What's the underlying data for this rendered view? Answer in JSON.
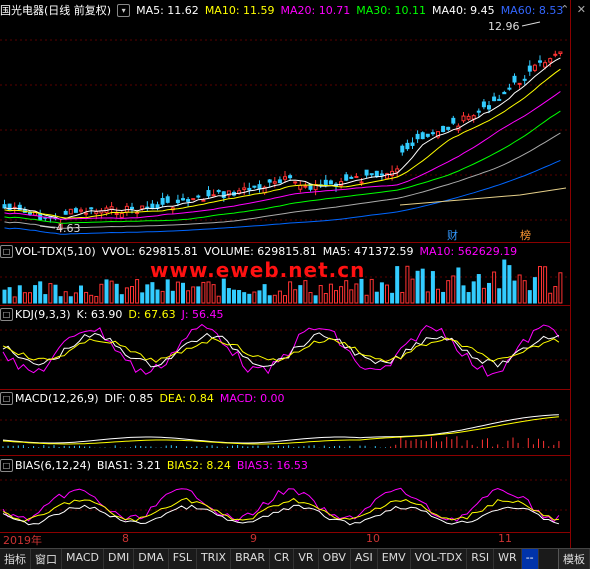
{
  "header": {
    "stock_name": "国光电器",
    "period": "(日线 前复权)",
    "ma5": "MA5: 11.62",
    "ma10": "MA10: 11.59",
    "ma20": "MA20: 10.71",
    "ma30": "MA30: 10.11",
    "ma40": "MA40: 9.45",
    "ma60": "MA60: 8.53"
  },
  "price_panel": {
    "high_label": "12.96",
    "low_label": "4.63",
    "marker1": "财",
    "marker2": "榜"
  },
  "vol_panel": {
    "title": "VOL-TDX(5,10)",
    "vvol": "VVOL: 629815.81",
    "volume": "VOLUME: 629815.81",
    "ma5": "MA5: 471372.59",
    "ma10": "MA10: 562629.19"
  },
  "watermark": "www.eweb.net.cn",
  "kdj_panel": {
    "title": "KDJ(9,3,3)",
    "k": "K: 63.90",
    "d": "D: 67.63",
    "j": "J: 56.45"
  },
  "macd_panel": {
    "title": "MACD(12,26,9)",
    "dif": "DIF: 0.85",
    "dea": "DEA: 0.84",
    "macd": "MACD: 0.00"
  },
  "bias_panel": {
    "title": "BIAS(6,12,24)",
    "bias1": "BIAS1: 3.21",
    "bias2": "BIAS2: 8.24",
    "bias3": "BIAS3: 16.53"
  },
  "date_axis": {
    "year": "2019年",
    "m8": "8",
    "m9": "9",
    "m10": "10",
    "m11": "11"
  },
  "toolbar": {
    "tabs": [
      "指标",
      "窗口",
      "MACD",
      "DMI",
      "DMA",
      "FSL",
      "TRIX",
      "BRAR",
      "CR",
      "VR",
      "OBV",
      "ASI",
      "EMV",
      "VOL-TDX",
      "RSI",
      "WR"
    ],
    "more": "--",
    "template": "模板"
  },
  "colors": {
    "ma5": "#ffffff",
    "ma10": "#ffff00",
    "ma20": "#ff00ff",
    "ma30": "#00ff00",
    "ma40": "#ffffff",
    "ma60": "#0066ff",
    "up": "#ff3333",
    "down": "#33ccff"
  }
}
